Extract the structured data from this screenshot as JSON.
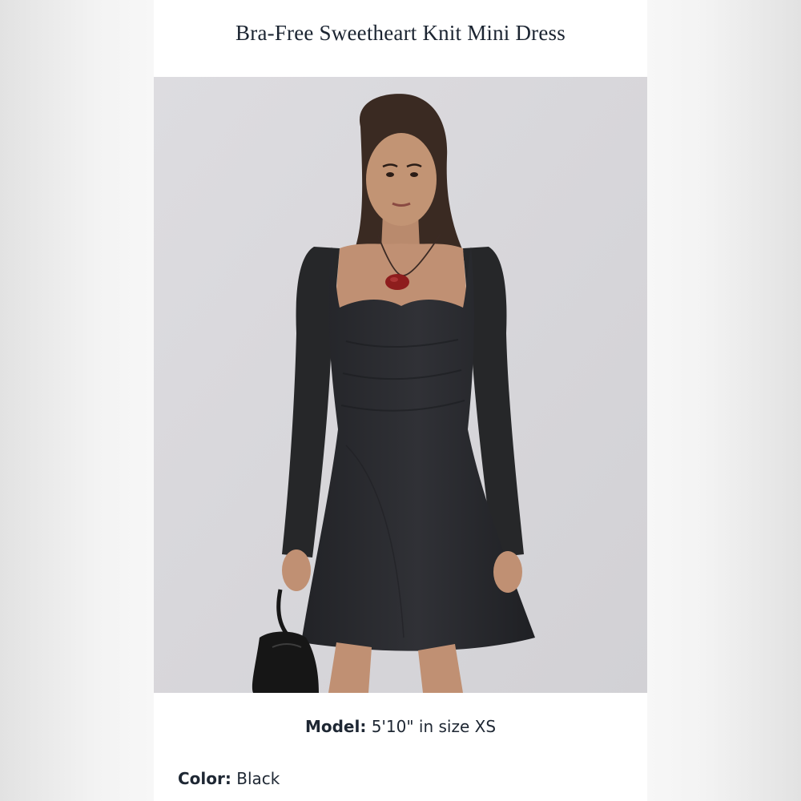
{
  "product": {
    "title": "Bra-Free Sweetheart Knit Mini Dress",
    "image_subject": "Model wearing a black long-sleeve sweetheart-neck knit mini dress with a red pendant necklace, holding a black handbag"
  },
  "details": {
    "model_label": "Model:",
    "model_value": "5'10\" in size XS",
    "color_label": "Color:",
    "color_value": "Black"
  },
  "colors": {
    "page_background": "#ececec",
    "card_background": "#ffffff",
    "photo_background": "#d9d8dc",
    "text": "#1e2733",
    "dress": "#2a2b2e",
    "pendant": "#8e1d1d"
  }
}
